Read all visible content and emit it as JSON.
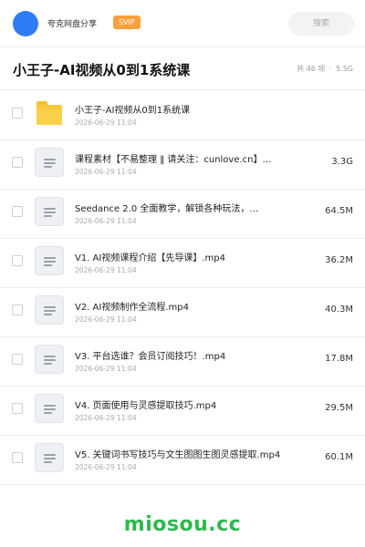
{
  "header": {
    "share_name": "夸克网盘分享",
    "badge": "SVIP",
    "search_placeholder": "搜索"
  },
  "folder": {
    "title": "小王子-AI视频从0到1系统课",
    "summary_count": "共 46 项",
    "summary_sep": "·",
    "summary_size": "5.5G"
  },
  "files": [
    {
      "icon": "folder-icon",
      "name": "小王子-AI视频从0到1系统课",
      "date": "2026-06-29 11:04",
      "size": ""
    },
    {
      "icon": "document-icon",
      "name": "课程素材【不易整理 ‖ 请关注：cunlove.cn】…",
      "date": "2026-06-29 11:04",
      "size": "3.3G"
    },
    {
      "icon": "document-icon",
      "name": "Seedance 2.0 全面教学，解锁各种玩法，…",
      "date": "2026-06-29 11:04",
      "size": "64.5M"
    },
    {
      "icon": "document-icon",
      "name": "V1. AI视频课程介绍【先导课】.mp4",
      "date": "2026-06-29 11:04",
      "size": "36.2M"
    },
    {
      "icon": "document-icon",
      "name": "V2. AI视频制作全流程.mp4",
      "date": "2026-06-29 11:04",
      "size": "40.3M"
    },
    {
      "icon": "document-icon",
      "name": "V3. 平台选谁？会员订阅技巧！.mp4",
      "date": "2026-06-29 11:04",
      "size": "17.8M"
    },
    {
      "icon": "document-icon",
      "name": "V4. 页面使用与灵感提取技巧.mp4",
      "date": "2026-06-29 11:04",
      "size": "29.5M"
    },
    {
      "icon": "document-icon",
      "name": "V5. 关键词书写技巧与文生图图生图灵感提取.mp4",
      "date": "2026-06-29 11:04",
      "size": "60.1M"
    }
  ],
  "watermark": "miosou.cc",
  "colors": {
    "avatar": "#2f7cf6",
    "badge": "#f8a03a",
    "folder": "#f8c93b",
    "watermark": "#2eb84d"
  }
}
